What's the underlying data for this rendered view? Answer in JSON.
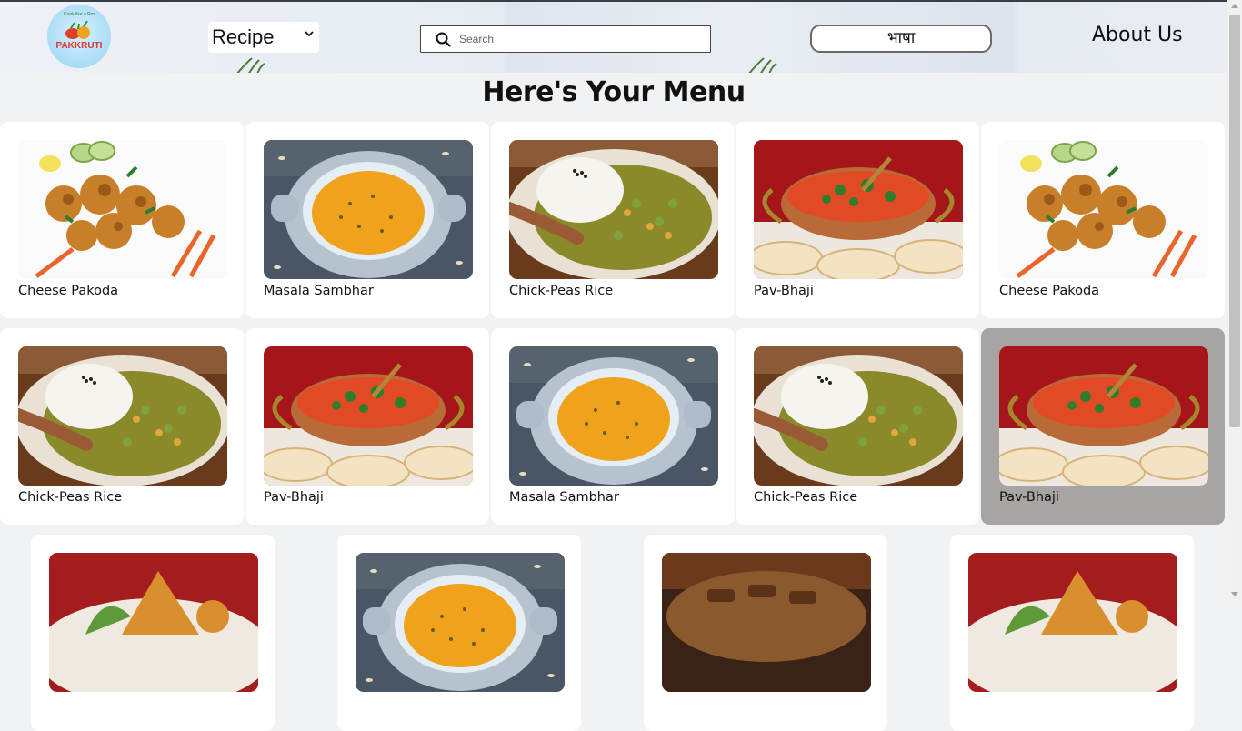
{
  "header": {
    "logo_text": "PAKKRUTI",
    "logo_tagline": "Cook like a Pro",
    "recipe_select": {
      "value": "Recipe"
    },
    "search": {
      "placeholder": "Search"
    },
    "language_button": "भाषा",
    "about_link": "About Us"
  },
  "main": {
    "title": "Here's Your Menu",
    "cards": [
      {
        "name": "Cheese Pakoda",
        "image": "pakoda"
      },
      {
        "name": "Masala Sambhar",
        "image": "sambhar"
      },
      {
        "name": "Chick-Peas Rice",
        "image": "rice"
      },
      {
        "name": "Pav-Bhaji",
        "image": "pavbhaji"
      },
      {
        "name": "Cheese Pakoda",
        "image": "pakoda"
      },
      {
        "name": "Chick-Peas Rice",
        "image": "rice"
      },
      {
        "name": "Pav-Bhaji",
        "image": "pavbhaji"
      },
      {
        "name": "Masala Sambhar",
        "image": "sambhar"
      },
      {
        "name": "Chick-Peas Rice",
        "image": "rice"
      },
      {
        "name": "Pav-Bhaji",
        "image": "pavbhaji",
        "hovered": true
      },
      {
        "name": "",
        "image": "samosa"
      },
      {
        "name": "",
        "image": "sambhar"
      },
      {
        "name": "",
        "image": "grill"
      },
      {
        "name": "",
        "image": "samosa"
      }
    ]
  }
}
